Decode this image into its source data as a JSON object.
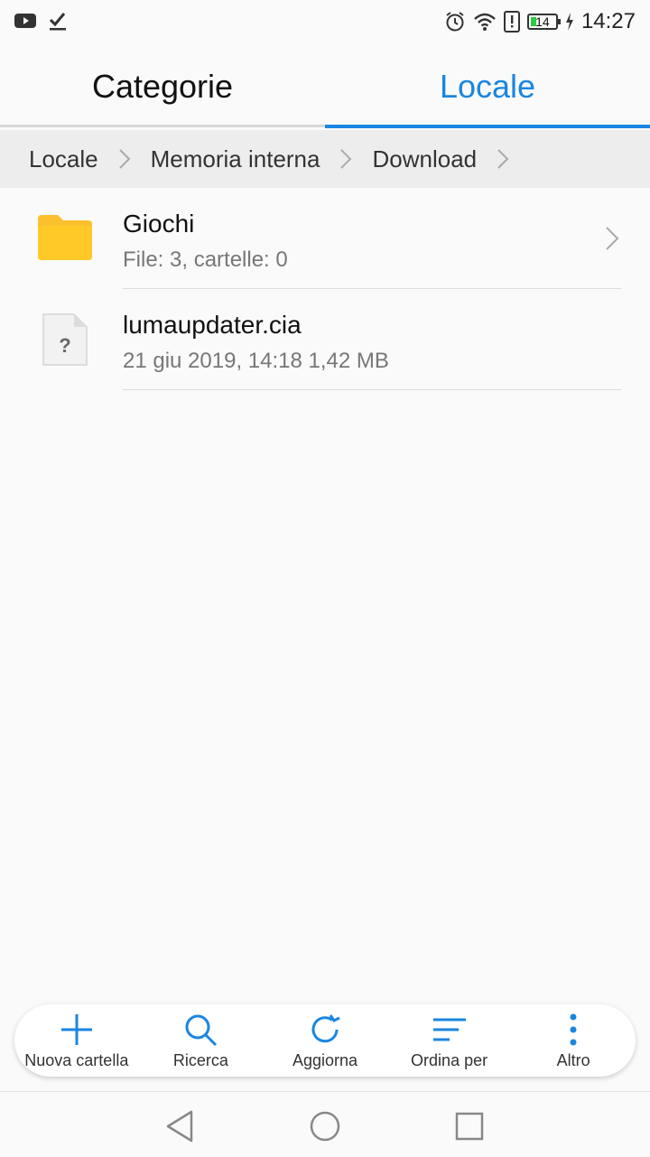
{
  "status_bar": {
    "time": "14:27",
    "battery_level": "14",
    "icons": [
      "youtube-icon",
      "check-icon",
      "alarm-icon",
      "wifi-icon",
      "alert-icon",
      "battery-icon",
      "charging-icon"
    ]
  },
  "tabs": [
    {
      "label": "Categorie",
      "active": false
    },
    {
      "label": "Locale",
      "active": true
    }
  ],
  "breadcrumb": [
    "Locale",
    "Memoria interna",
    "Download"
  ],
  "files": [
    {
      "name": "Giochi",
      "meta": "File: 3, cartelle: 0",
      "type": "folder"
    },
    {
      "name": "lumaupdater.cia",
      "meta": "21 giu 2019, 14:18 1,42 MB",
      "type": "unknown"
    }
  ],
  "toolbar": {
    "new_folder": "Nuova cartella",
    "search": "Ricerca",
    "refresh": "Aggiorna",
    "sort": "Ordina per",
    "more": "Altro"
  },
  "colors": {
    "accent": "#1a86e0",
    "folder": "#fbc02d",
    "battery": "#2ecc40"
  }
}
